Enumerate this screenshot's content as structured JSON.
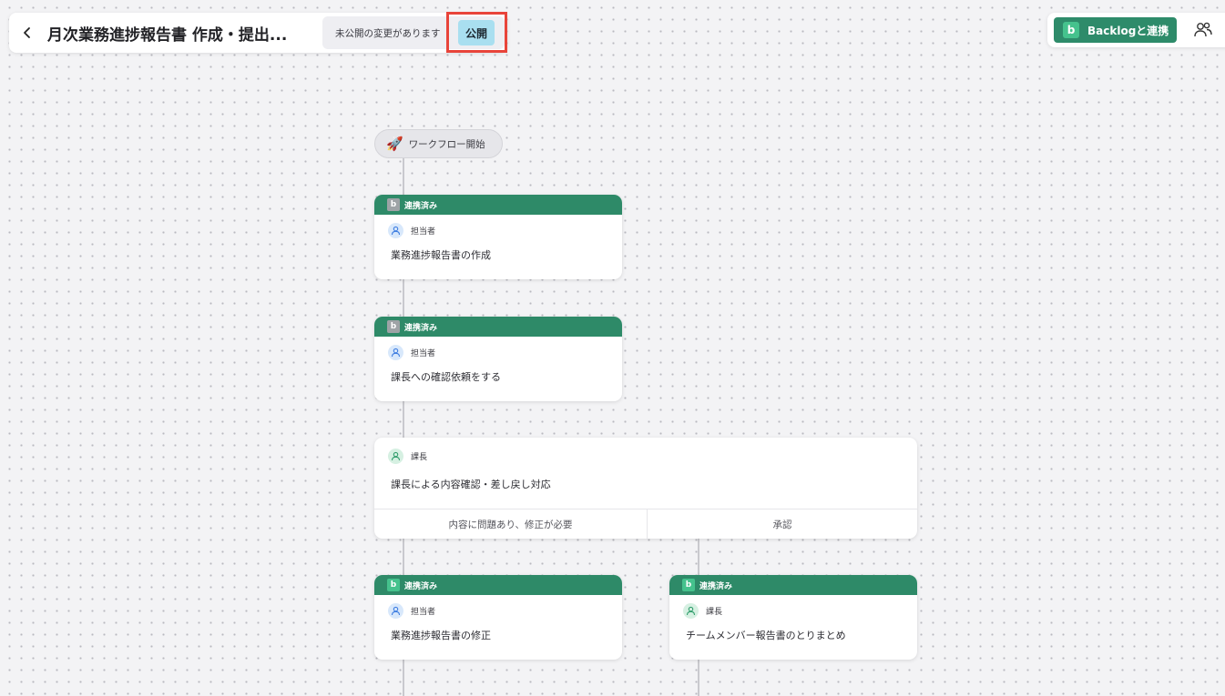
{
  "header": {
    "title": "月次業務進捗報告書 作成・提出...",
    "unpublished_notice": "未公開の変更があります",
    "publish_label": "公開"
  },
  "toolbar": {
    "backlog_logo": "b",
    "backlog_label": "Backlogと連携"
  },
  "workflow": {
    "start_label": "ワークフロー開始",
    "cards": [
      {
        "header": "連携済み",
        "role": "担当者",
        "task": "業務進捗報告書の作成"
      },
      {
        "header": "連携済み",
        "role": "担当者",
        "task": "課長への確認依頼をする"
      },
      {
        "role": "課長",
        "task": "課長による内容確認・差し戻し対応",
        "options": [
          "内容に問題あり、修正が必要",
          "承認"
        ]
      },
      {
        "header": "連携済み",
        "role": "担当者",
        "task": "業務進捗報告書の修正"
      },
      {
        "header": "連携済み",
        "role": "課長",
        "task": "チームメンバー報告書のとりまとめ"
      }
    ]
  },
  "colors": {
    "card_header": "#2e8a68",
    "publish_button": "#a9dff0",
    "highlight": "#e8443a",
    "backlog_button": "#2e8b6a"
  }
}
